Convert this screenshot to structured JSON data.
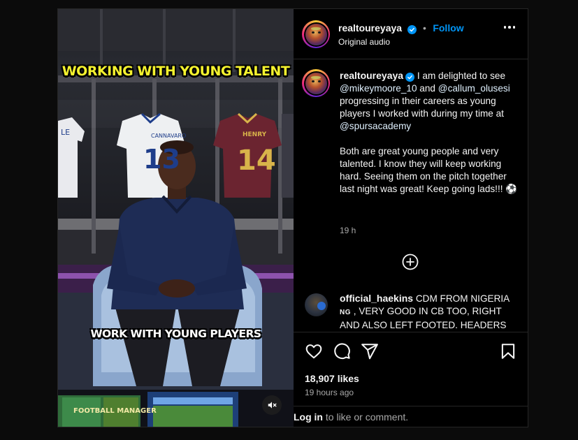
{
  "post": {
    "username": "realtoureyaya",
    "follow_label": "Follow",
    "dot": "•",
    "audio": "Original audio",
    "video": {
      "overlay_top": "WORKING WITH YOUNG TALENT",
      "overlay_bottom": "WORK WITH YOUNG PLAYERS",
      "jersey_left_name": "CANNAVARO",
      "jersey_left_number": "13",
      "jersey_right_name": "HENRY",
      "jersey_right_number": "14",
      "jersey_far_left_letters": "LE",
      "book_title": "FOOTBALL MANAGER"
    },
    "caption": {
      "username": "realtoureyaya",
      "line1": " I am delighted to see",
      "mention1": "@mikeymoore_10",
      "line2": " and",
      "mention2": "@callum_olusesi",
      "line3": " progressing in their careers as young players I worked with during my time at",
      "mention3": "@spursacademy",
      "paragraph2": "Both are great young people and very talented. I know they will keep working hard. Seeing them on the pitch together last night was great! Keep going lads!!! ⚽",
      "time": "19 h"
    },
    "comment": {
      "username": "official_haekins",
      "text": " CDM FROM NIGERIA ",
      "flag": "NG",
      "text2": " , VERY GOOD IN CB TOO, RIGHT AND ALSO LEFT FOOTED. HEADERS ARE MY"
    },
    "likes": "18,907 likes",
    "posted": "19 hours ago",
    "login_link": "Log in",
    "login_rest": " to like or comment."
  },
  "icons": [
    "verified-badge-icon",
    "more-options-icon",
    "load-more-comments-icon",
    "heart-icon",
    "comment-icon",
    "share-icon",
    "bookmark-icon",
    "muted-speaker-icon"
  ],
  "colors": {
    "accent": "#0095f6",
    "overlay_top_text": "#f4f22e",
    "background": "#000000",
    "secondary_text": "#a8a8a8"
  }
}
